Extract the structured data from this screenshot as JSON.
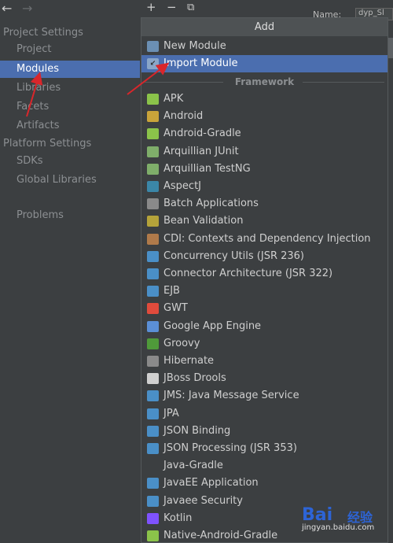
{
  "left_panel": {
    "back_glyph": "←",
    "forward_glyph": "→",
    "sections": [
      "Project Settings",
      "Platform Settings"
    ],
    "project_items": [
      "Project",
      "Modules",
      "Libraries",
      "Facets",
      "Artifacts"
    ],
    "platform_items": [
      "SDKs",
      "Global Libraries"
    ],
    "other_items": [
      "Problems"
    ],
    "selected": "Modules"
  },
  "toolbar": {
    "add_glyph": "+",
    "remove_glyph": "−",
    "copy_glyph": "⧉"
  },
  "right_panel": {
    "name_label": "Name:",
    "name_value": "dyp_Sl"
  },
  "popup": {
    "title": "Add",
    "top_items": [
      {
        "label": "New Module",
        "icon": "folder-module-icon"
      },
      {
        "label": "Import Module",
        "icon": "import-module-icon"
      }
    ],
    "section_label": "Framework",
    "frameworks": [
      {
        "label": "APK",
        "icon": "android-icon",
        "color": "#8bc34a"
      },
      {
        "label": "Android",
        "icon": "android-folder-icon",
        "color": "#c9a33a"
      },
      {
        "label": "Android-Gradle",
        "icon": "android-icon",
        "color": "#8bc34a"
      },
      {
        "label": "Arquillian JUnit",
        "icon": "alien-icon",
        "color": "#7fae6a"
      },
      {
        "label": "Arquillian TestNG",
        "icon": "alien-icon",
        "color": "#7fae6a"
      },
      {
        "label": "AspectJ",
        "icon": "aspectj-icon",
        "color": "#3b87a8"
      },
      {
        "label": "Batch Applications",
        "icon": "batch-icon",
        "color": "#8a8a8a"
      },
      {
        "label": "Bean Validation",
        "icon": "bean-icon",
        "color": "#b5a33a"
      },
      {
        "label": "CDI: Contexts and Dependency Injection",
        "icon": "cdi-icon",
        "color": "#b07a4a"
      },
      {
        "label": "Concurrency Utils (JSR 236)",
        "icon": "javaee-icon",
        "color": "#4a8fc7"
      },
      {
        "label": "Connector Architecture (JSR 322)",
        "icon": "javaee-icon",
        "color": "#4a8fc7"
      },
      {
        "label": "EJB",
        "icon": "ejb-icon",
        "color": "#4a8fc7"
      },
      {
        "label": "GWT",
        "icon": "google-icon",
        "color": "#e04b3c"
      },
      {
        "label": "Google App Engine",
        "icon": "app-engine-icon",
        "color": "#5b8fd6"
      },
      {
        "label": "Groovy",
        "icon": "groovy-icon",
        "color": "#4f9a3a"
      },
      {
        "label": "Hibernate",
        "icon": "hibernate-icon",
        "color": "#8a8a8a"
      },
      {
        "label": "JBoss Drools",
        "icon": "drools-icon",
        "color": "#d0d0d0"
      },
      {
        "label": "JMS: Java Message Service",
        "icon": "javaee-icon",
        "color": "#4a8fc7"
      },
      {
        "label": "JPA",
        "icon": "javaee-icon",
        "color": "#4a8fc7"
      },
      {
        "label": "JSON Binding",
        "icon": "javaee-icon",
        "color": "#4a8fc7"
      },
      {
        "label": "JSON Processing (JSR 353)",
        "icon": "javaee-icon",
        "color": "#4a8fc7"
      },
      {
        "label": "Java-Gradle",
        "icon": "",
        "color": ""
      },
      {
        "label": "JavaEE Application",
        "icon": "javaee-icon",
        "color": "#4a8fc7"
      },
      {
        "label": "Javaee Security",
        "icon": "javaee-icon",
        "color": "#4a8fc7"
      },
      {
        "label": "Kotlin",
        "icon": "kotlin-icon",
        "color": "#7f52ff"
      },
      {
        "label": "Native-Android-Gradle",
        "icon": "android-icon",
        "color": "#8bc34a"
      }
    ]
  },
  "watermark": {
    "brand": "Bai",
    "brand2": "经验",
    "url": "jingyan.baidu.com"
  },
  "colors": {
    "selection": "#4b6eaf",
    "background": "#3c3f41",
    "arrow": "#d9262b"
  }
}
